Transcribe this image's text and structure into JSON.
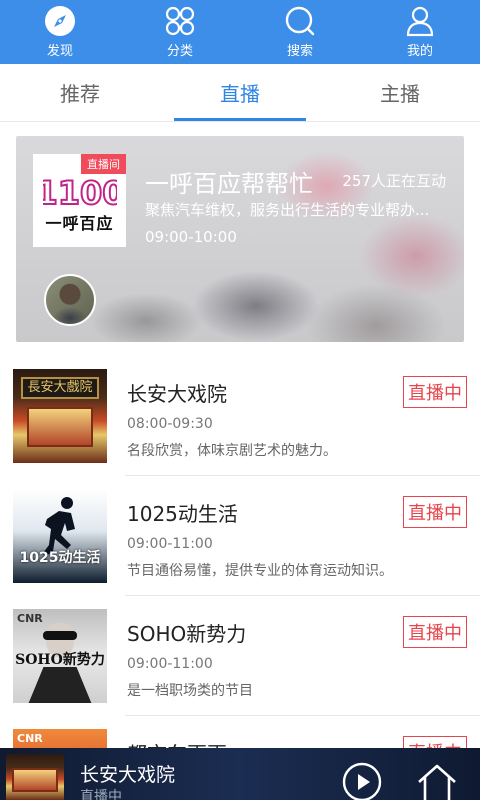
{
  "topnav": {
    "items": [
      {
        "label": "发现",
        "icon": "compass-icon"
      },
      {
        "label": "分类",
        "icon": "grid-icon"
      },
      {
        "label": "搜索",
        "icon": "search-icon"
      },
      {
        "label": "我的",
        "icon": "user-icon"
      }
    ],
    "background": "#3c8ee8"
  },
  "subtabs": {
    "items": [
      {
        "label": "推荐",
        "active": false
      },
      {
        "label": "直播",
        "active": true
      },
      {
        "label": "主播",
        "active": false
      }
    ],
    "active_color": "#2f86e6"
  },
  "featured": {
    "badge": "直播间",
    "cover_logo_number": "1100",
    "cover_logo_text": "一呼百应",
    "title": "一呼百应帮帮忙",
    "interaction_count": "257人正在互动",
    "description": "聚焦汽车维权，服务出行生活的专业帮办...",
    "time": "09:00-10:00"
  },
  "programs": [
    {
      "title": "长安大戏院",
      "time": "08:00-09:30",
      "description": "名段欣赏，体味京剧艺术的魅力。",
      "status": "直播中",
      "sign": "長安大戲院"
    },
    {
      "title": "1025动生活",
      "time": "09:00-11:00",
      "description": "节目通俗易懂，提供专业的体育运动知识。",
      "status": "直播中",
      "caption": "1025动生活"
    },
    {
      "title": "SOHO新势力",
      "time": "09:00-11:00",
      "description": "是一档职场类的节目",
      "status": "直播中",
      "caption": "SOHO新势力",
      "cnr": "CNR"
    },
    {
      "title": "都市车更更",
      "status": "直播中",
      "cnr": "CNR"
    }
  ],
  "player": {
    "title": "长安大戏院",
    "subtitle": "直播中",
    "play_icon": "play-icon",
    "home_icon": "home-icon"
  },
  "colors": {
    "live_tag": "#e5454d",
    "player_bg": "#1b2d52"
  }
}
